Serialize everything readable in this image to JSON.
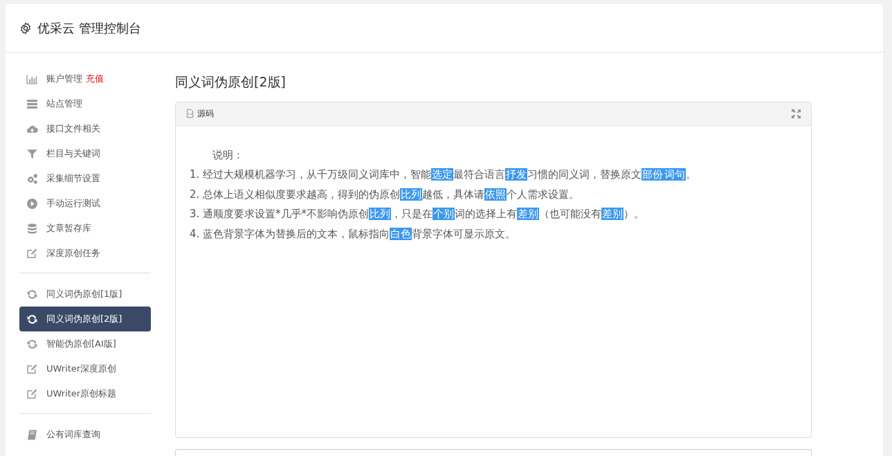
{
  "header": {
    "title": "优采云 管理控制台"
  },
  "sidebar": {
    "groups": [
      {
        "items": [
          {
            "label": "账户管理",
            "badge": "充值",
            "selected": false
          },
          {
            "label": "站点管理",
            "selected": false
          },
          {
            "label": "接口文件相关",
            "selected": false
          },
          {
            "label": "栏目与关键词",
            "selected": false
          },
          {
            "label": "采集细节设置",
            "selected": false
          },
          {
            "label": "手动运行测试",
            "selected": false
          },
          {
            "label": "文章暂存库",
            "selected": false
          },
          {
            "label": "深度原创任务",
            "selected": false
          }
        ]
      },
      {
        "items": [
          {
            "label": "同义词伪原创[1版]",
            "selected": false
          },
          {
            "label": "同义词伪原创[2版]",
            "selected": true
          },
          {
            "label": "智能伪原创[AI版]",
            "selected": false
          },
          {
            "label": "UWriter深度原创",
            "selected": false
          },
          {
            "label": "UWriter原创标题",
            "selected": false
          }
        ]
      },
      {
        "items": [
          {
            "label": "公有词库查询",
            "selected": false
          }
        ]
      }
    ]
  },
  "content": {
    "heading": "同义词伪原创[2版]",
    "editor": {
      "toolbar_label": "源码",
      "intro": "说明：",
      "lines": [
        [
          {
            "text": "1. 经过大规模机器学习，从千万级同义词库中，智能",
            "highlighted": false
          },
          {
            "text": "选定",
            "highlighted": true
          },
          {
            "text": "最符合语言",
            "highlighted": false
          },
          {
            "text": "抒发",
            "highlighted": true
          },
          {
            "text": "习惯的同义词，替换原文",
            "highlighted": false
          },
          {
            "text": "部份",
            "highlighted": true
          },
          {
            "text": "词句",
            "highlighted": true
          },
          {
            "text": "。",
            "highlighted": false
          }
        ],
        [
          {
            "text": "2. 总体上语义相似度要求越高，得到的伪原创",
            "highlighted": false
          },
          {
            "text": "比列",
            "highlighted": true
          },
          {
            "text": "越低，具体请",
            "highlighted": false
          },
          {
            "text": "依照",
            "highlighted": true
          },
          {
            "text": "个人需求设置。",
            "highlighted": false
          }
        ],
        [
          {
            "text": "3. 通顺度要求设置*几乎*不影响伪原创",
            "highlighted": false
          },
          {
            "text": "比列",
            "highlighted": true
          },
          {
            "text": "，只是在",
            "highlighted": false
          },
          {
            "text": "个别",
            "highlighted": true
          },
          {
            "text": "词的选择上有",
            "highlighted": false
          },
          {
            "text": "差别",
            "highlighted": true
          },
          {
            "text": "（也可能没有",
            "highlighted": false
          },
          {
            "text": "差别",
            "highlighted": true
          },
          {
            "text": "）。",
            "highlighted": false
          }
        ],
        [
          {
            "text": "4. 蓝色背景字体为替换后的文本，鼠标指向",
            "highlighted": false
          },
          {
            "text": "白色",
            "highlighted": true
          },
          {
            "text": "背景字体可显示原文。",
            "highlighted": false
          }
        ]
      ]
    }
  }
}
